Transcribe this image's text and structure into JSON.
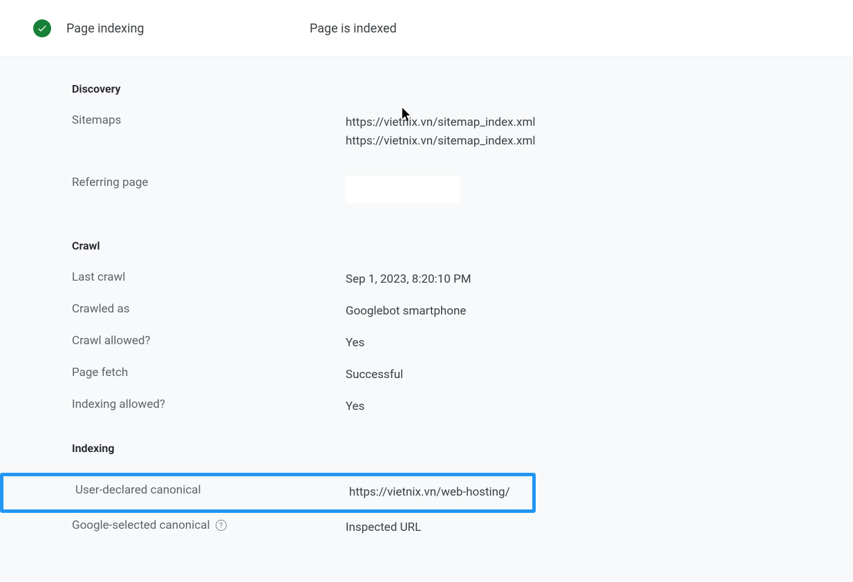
{
  "header": {
    "title": "Page indexing",
    "status": "Page is indexed"
  },
  "discovery": {
    "section_title": "Discovery",
    "sitemaps_label": "Sitemaps",
    "sitemaps_value_1": "https://vietnix.vn/sitemap_index.xml",
    "sitemaps_value_2": "https://vietnix.vn/sitemap_index.xml",
    "referring_page_label": "Referring page",
    "referring_page_value": ""
  },
  "crawl": {
    "section_title": "Crawl",
    "last_crawl_label": "Last crawl",
    "last_crawl_value": "Sep 1, 2023, 8:20:10 PM",
    "crawled_as_label": "Crawled as",
    "crawled_as_value": "Googlebot smartphone",
    "crawl_allowed_label": "Crawl allowed?",
    "crawl_allowed_value": "Yes",
    "page_fetch_label": "Page fetch",
    "page_fetch_value": "Successful",
    "indexing_allowed_label": "Indexing allowed?",
    "indexing_allowed_value": "Yes"
  },
  "indexing": {
    "section_title": "Indexing",
    "user_canonical_label": "User-declared canonical",
    "user_canonical_value": "https://vietnix.vn/web-hosting/",
    "google_canonical_label": "Google-selected canonical",
    "google_canonical_value": "Inspected URL"
  }
}
